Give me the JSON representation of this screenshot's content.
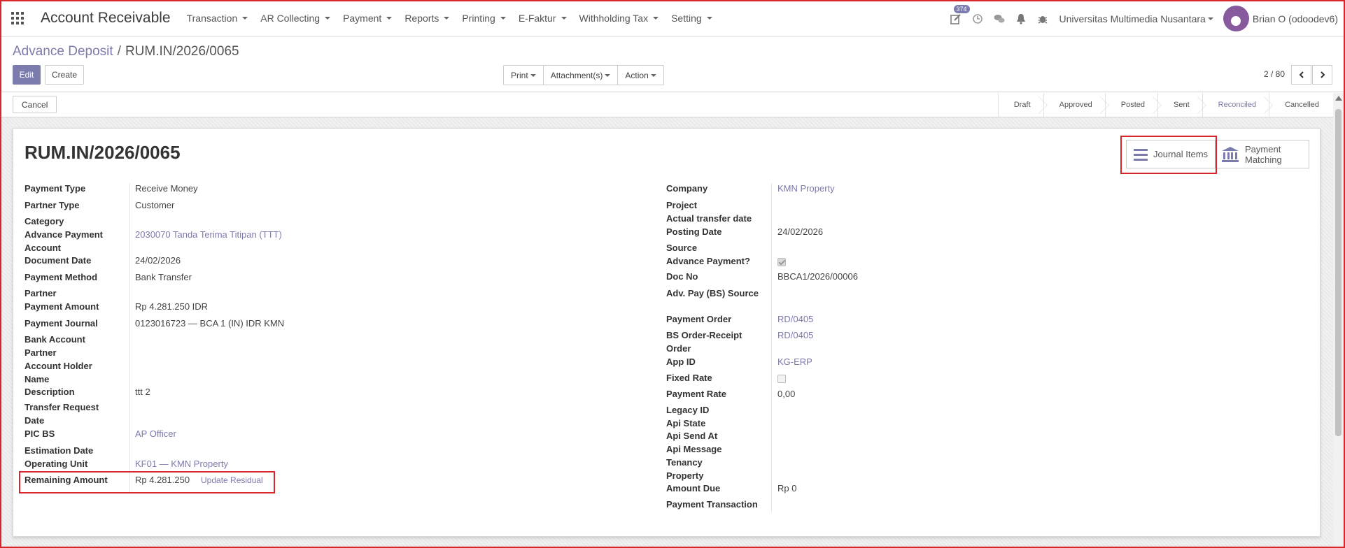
{
  "navbar": {
    "app_title": "Account Receivable",
    "menu": [
      "Transaction",
      "AR Collecting",
      "Payment",
      "Reports",
      "Printing",
      "E-Faktur",
      "Withholding Tax",
      "Setting"
    ],
    "activity_badge": "374",
    "company": "Universitas Multimedia Nusantara",
    "user": "Brian O (odoodev6)"
  },
  "breadcrumb": {
    "parent": "Advance Deposit",
    "separator": "/",
    "current": "RUM.IN/2026/0065"
  },
  "toolbar": {
    "edit": "Edit",
    "create": "Create",
    "print": "Print",
    "attachments": "Attachment(s)",
    "action": "Action",
    "pager": "2 / 80"
  },
  "status": {
    "cancel": "Cancel",
    "stages": [
      "Draft",
      "Approved",
      "Posted",
      "Sent",
      "Reconciled",
      "Cancelled"
    ],
    "active_stage": "Reconciled"
  },
  "record": {
    "title": "RUM.IN/2026/0065",
    "smart_buttons": {
      "journal_items": "Journal Items",
      "payment_matching_1": "Payment",
      "payment_matching_2": "Matching"
    }
  },
  "left_fields": {
    "payment_type": {
      "label": "Payment Type",
      "value": "Receive Money"
    },
    "partner_type": {
      "label": "Partner Type",
      "value": "Customer"
    },
    "category": {
      "label": "Category",
      "value": ""
    },
    "advance_account": {
      "label1": "Advance Payment",
      "label2": "Account",
      "value": "2030070 Tanda Terima Titipan (TTT)"
    },
    "document_date": {
      "label": "Document Date",
      "value": "24/02/2026"
    },
    "payment_method": {
      "label": "Payment Method",
      "value": "Bank Transfer"
    },
    "partner": {
      "label": "Partner",
      "value": ""
    },
    "payment_amount": {
      "label": "Payment Amount",
      "value": "Rp 4.281.250  IDR"
    },
    "payment_journal": {
      "label": "Payment Journal",
      "value": "0123016723 — BCA 1 (IN) IDR KMN"
    },
    "bank_account": {
      "label1": "Bank Account",
      "label2": "Partner",
      "value": ""
    },
    "holder_name": {
      "label1": "Account Holder",
      "label2": "Name",
      "value": ""
    },
    "description": {
      "label": "Description",
      "value": "ttt 2"
    },
    "transfer_request": {
      "label1": "Transfer Request",
      "label2": "Date",
      "value": ""
    },
    "pic_bs": {
      "label": "PIC BS",
      "value": "AP Officer"
    },
    "estimation_date": {
      "label": "Estimation Date",
      "value": ""
    },
    "operating_unit": {
      "label": "Operating Unit",
      "value": "KF01 — KMN Property"
    },
    "remaining_amount": {
      "label": "Remaining Amount",
      "value": "Rp 4.281.250",
      "action": "Update Residual"
    }
  },
  "right_fields": {
    "company": {
      "label": "Company",
      "value": "KMN Property"
    },
    "project": {
      "label": "Project",
      "value": ""
    },
    "actual_transfer": {
      "label": "Actual transfer date",
      "value": ""
    },
    "posting_date": {
      "label": "Posting Date",
      "value": "24/02/2026"
    },
    "source": {
      "label": "Source",
      "value": ""
    },
    "advance_payment": {
      "label": "Advance Payment?",
      "checked": true
    },
    "doc_no": {
      "label": "Doc No",
      "value": "BBCA1/2026/00006"
    },
    "adv_pay_source": {
      "label": "Adv. Pay (BS) Source",
      "value": ""
    },
    "payment_order": {
      "label": "Payment Order",
      "value": "RD/0405"
    },
    "bs_order_receipt": {
      "label1": "BS Order-Receipt",
      "label2": "Order",
      "value": "RD/0405"
    },
    "app_id": {
      "label": "App ID",
      "value": "KG-ERP"
    },
    "fixed_rate": {
      "label": "Fixed Rate",
      "checked": false
    },
    "payment_rate": {
      "label": "Payment Rate",
      "value": "0,00"
    },
    "legacy_id": {
      "label": "Legacy ID",
      "value": ""
    },
    "api_state": {
      "label": "Api State",
      "value": ""
    },
    "api_send_at": {
      "label": "Api Send At",
      "value": ""
    },
    "api_message": {
      "label": "Api Message",
      "value": ""
    },
    "tenancy_property": {
      "label1": "Tenancy",
      "label2": "Property",
      "value": ""
    },
    "amount_due": {
      "label": "Amount Due",
      "value": "Rp 0"
    },
    "payment_transaction": {
      "label": "Payment Transaction",
      "value": ""
    }
  },
  "colors": {
    "primary": "#7c7bad",
    "highlight": "#d9252b"
  }
}
